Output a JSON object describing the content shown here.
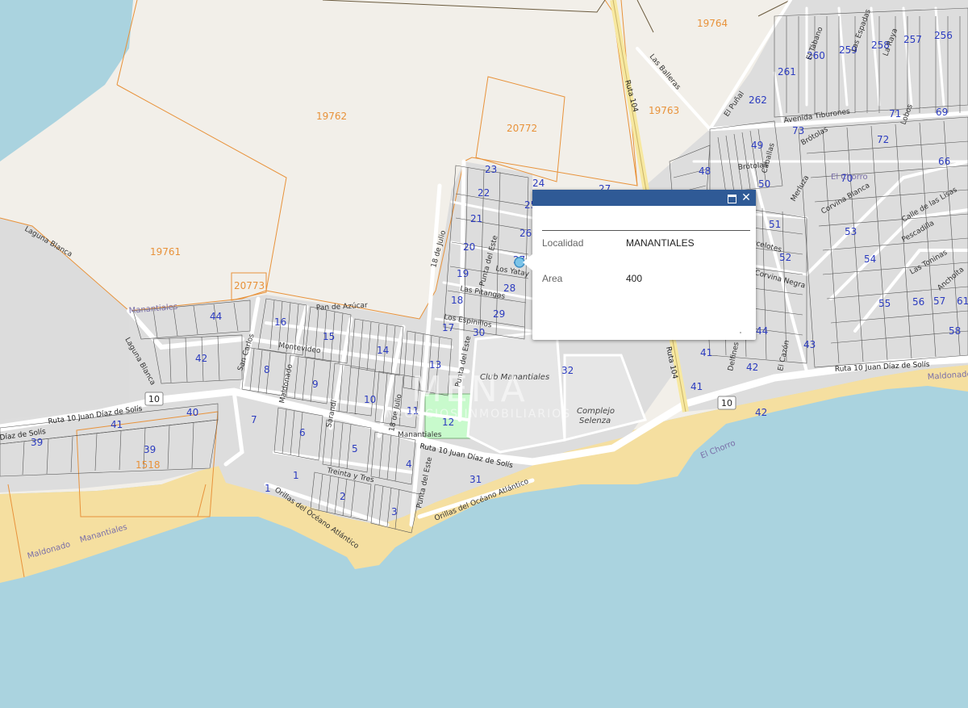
{
  "popup": {
    "maximize_icon": "maximize-icon",
    "close_icon": "close-icon",
    "close_label": "✕",
    "fields": [
      {
        "key": "Localidad",
        "value": "MANANTIALES"
      },
      {
        "key": "Area",
        "value": "400"
      }
    ]
  },
  "parcels": {
    "p19762": "19762",
    "p19761": "19761",
    "p19764": "19764",
    "p19763": "19763",
    "p20772": "20772",
    "p20773": "20773",
    "p1518": "1518"
  },
  "blocks": [
    "44",
    "42",
    "41",
    "40",
    "39",
    "39",
    "16",
    "15",
    "14",
    "13",
    "9",
    "8",
    "7",
    "6",
    "1",
    "1",
    "2",
    "3",
    "4",
    "5",
    "10",
    "11",
    "12",
    "17",
    "18",
    "19",
    "20",
    "21",
    "22",
    "23",
    "24",
    "25",
    "26",
    "27",
    "28",
    "29",
    "30",
    "31",
    "32",
    "262",
    "261",
    "260",
    "259",
    "258",
    "257",
    "256",
    "71",
    "69",
    "72",
    "66",
    "70",
    "73",
    "49",
    "48",
    "50",
    "51",
    "52",
    "53",
    "54",
    "55",
    "56",
    "57",
    "61",
    "58",
    "44",
    "43",
    "42",
    "41",
    "41",
    "42",
    "27",
    "18"
  ],
  "streets": {
    "ruta10_a": "Ruta 10 Juan Díaz de Solís",
    "ruta10_b": "Ruta 10 Juan Díaz de Solís",
    "ruta10_c": "Ruta 10 Juan Díaz de Solís",
    "ruta10_d": "Díaz de Solís",
    "ruta104": "Ruta 104",
    "ruta104_b": "Ruta 104",
    "laguna_blanca": "Laguna Blanca",
    "laguna_blanca2": "Laguna Blanca",
    "pan_azucar": "Pan de Azúcar",
    "montevideo": "Montevideo",
    "maldonado": "Maldonado",
    "san_carlos": "San Carlos",
    "sarandi": "Sarandí",
    "treinta_tres": "Treinta y Tres",
    "orillas1": "Orillas del Océano Atlántico",
    "orillas2": "Orillas del Océano Atlántico",
    "dieciocho": "18 de Julio",
    "dieciocho2": "18 de Julio",
    "punta_este": "Punta del Este",
    "punta_este2": "Punta del Este",
    "punta_este3": "Punta del Este",
    "los_yatay": "Los Yatay",
    "las_pitangas": "Las Pitangas",
    "los_espinillos": "Los Espinillos",
    "las_balleras": "Las Balleras",
    "el_puñal": "El Puñal",
    "avenida_tiburones": "Avenida Tiburones",
    "brotolas": "Brótolas",
    "brotolas2": "Brótolas",
    "lobos": "Lobos",
    "corvina_negra": "Corvina Negra",
    "corvina_blanca": "Corvina Blanca",
    "ocelotes": "Ocelotes",
    "pescadilla": "Pescadilla",
    "calle_lisas": "Calle de las Lisas",
    "anchoita": "Anchoíta",
    "las_toninas": "Las Toninas",
    "caballas": "Caballas",
    "merluza": "Merluza",
    "delfines": "Delfines",
    "cazon": "El Cazón",
    "el_chorro": "El Chorro",
    "el_chorro2": "El Chorro",
    "manantiales": "Manantiales",
    "manantiales_area": "Manantiales",
    "maldonado_area": "Maldonado",
    "manantiales_area2": "Manantiales",
    "maldonado_area2": "Maldonado",
    "club": "Club Manantiales",
    "complejo": "Complejo",
    "selenza": "Selenza",
    "el_tabano": "El Tábano",
    "las_espadas": "Las Espadas",
    "la_raya": "La Raya"
  },
  "shields": {
    "s10a": "10",
    "s10b": "10"
  },
  "watermark": {
    "line1": "MENA",
    "line2": "NEGOCIOS INMOBILIARIOS"
  },
  "colors": {
    "sea": "#aad3df",
    "land": "#f2efe9",
    "urban": "#dddddd",
    "beach": "#f5dfa0",
    "parcel_line": "#e8923a",
    "block_label": "#2b3bbf",
    "popup_header": "#2f5a96",
    "park": "#c8facc"
  }
}
